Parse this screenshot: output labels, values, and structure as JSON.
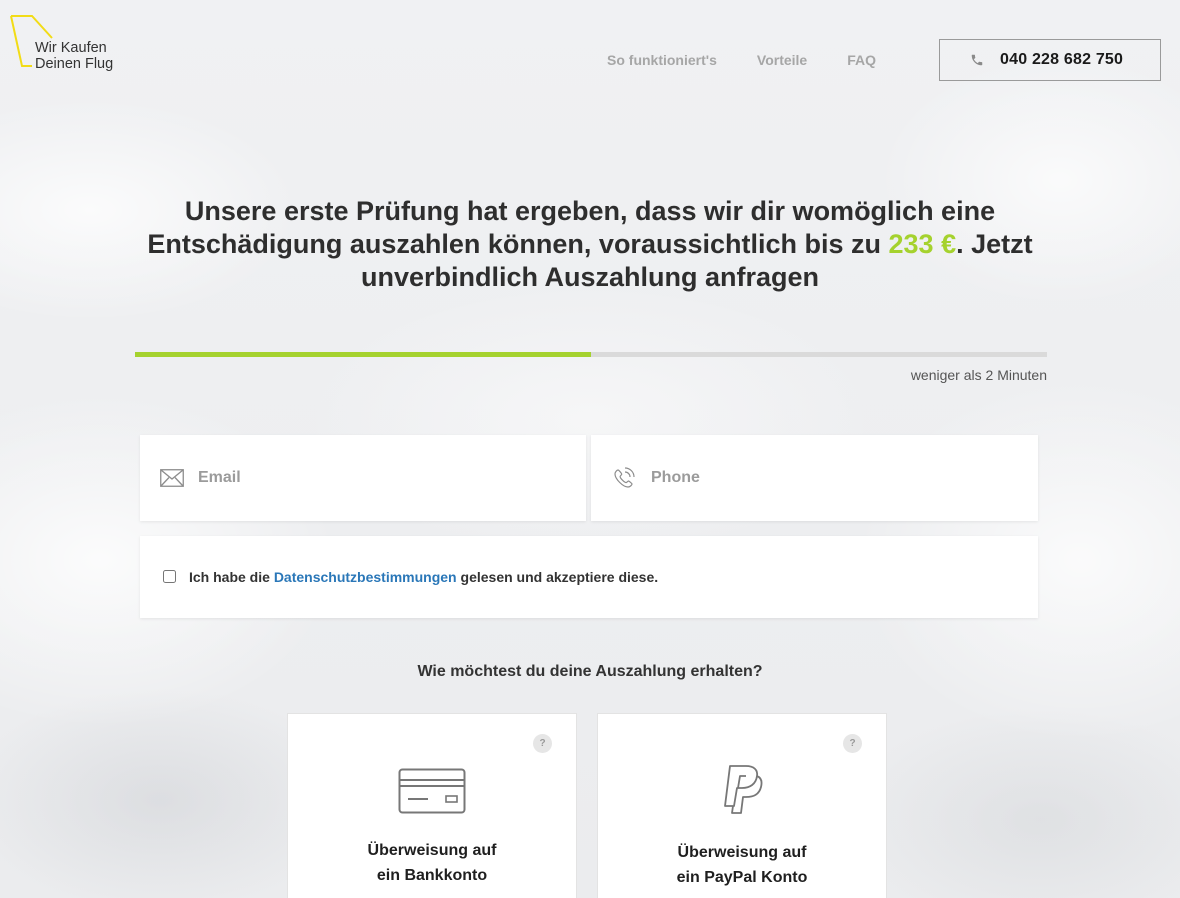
{
  "header": {
    "logo_line1": "Wir Kaufen",
    "logo_line2": "Deinen Flug",
    "nav": [
      "So funktioniert's",
      "Vorteile",
      "FAQ"
    ],
    "phone": "040 228 682 750"
  },
  "headline": {
    "part1": "Unsere erste Prüfung hat ergeben, dass wir dir womöglich eine Entschädigung auszahlen können, voraussichtlich bis zu ",
    "amount": "233 €",
    "part2": ". Jetzt unverbindlich Auszahlung anfragen"
  },
  "progress": {
    "fraction": 0.5,
    "note": "weniger als 2 Minuten"
  },
  "form": {
    "email_placeholder": "Email",
    "phone_placeholder": "Phone",
    "consent_before": "Ich habe die ",
    "consent_link": "Datenschutzbestimmungen",
    "consent_after": " gelesen und akzeptiere diese."
  },
  "payout": {
    "question": "Wie möchtest du deine Auszahlung erhalten?",
    "options": [
      {
        "line1": "Überweisung auf",
        "line2": "ein Bankkonto",
        "icon": "credit-card-icon"
      },
      {
        "line1": "Überweisung auf",
        "line2": "ein PayPal Konto",
        "icon": "paypal-icon"
      }
    ],
    "help_label": "?"
  },
  "colors": {
    "accent": "#a5d22e",
    "logo_yellow": "#f2dc16",
    "link": "#2a77b8"
  }
}
